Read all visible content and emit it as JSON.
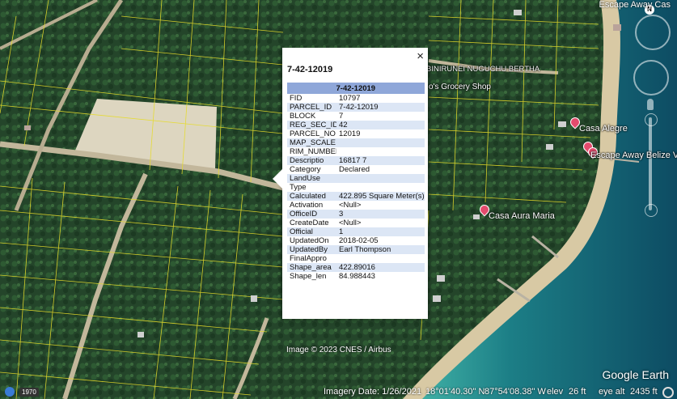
{
  "map": {
    "top_right_title": "Escape Away Cas",
    "north_indicator": "N",
    "road_label": "BINIRUNEI NUGUCHU BERTHA",
    "places": [
      {
        "label": "o's Grocery Shop",
        "pin": false
      },
      {
        "label": "Casa Alegre",
        "pin": true
      },
      {
        "label": "Escape Away Belize VR",
        "pin": true
      },
      {
        "label": "Casa Aura Maria",
        "pin": true
      }
    ],
    "copyright": "Image © 2023 CNES / Airbus",
    "logo": "Google Earth",
    "history_year": "1970"
  },
  "status_bar": {
    "imagery_date": "Imagery Date: 1/26/2021",
    "latitude": "18°01'40.30\" N",
    "longitude": "87°54'08.38\" W",
    "elev_label": "elev",
    "elev_value": "26 ft",
    "eye_alt_label": "eye alt",
    "eye_alt_value": "2435 ft"
  },
  "popup": {
    "title": "7-42-12019",
    "table_header": "7-42-12019",
    "close_glyph": "×",
    "rows": [
      {
        "field": "FID",
        "value": "10797"
      },
      {
        "field": "PARCEL_ID",
        "value": "7-42-12019"
      },
      {
        "field": "BLOCK",
        "value": "7"
      },
      {
        "field": "REG_SEC_ID",
        "value": "42"
      },
      {
        "field": "PARCEL_NO",
        "value": "12019"
      },
      {
        "field": "MAP_SCALE",
        "value": ""
      },
      {
        "field": "RIM_NUMBER",
        "value": ""
      },
      {
        "field": "Descriptio",
        "value": "16817 7"
      },
      {
        "field": "Category",
        "value": "Declared"
      },
      {
        "field": "LandUse",
        "value": ""
      },
      {
        "field": "Type",
        "value": ""
      },
      {
        "field": "Calculated",
        "value": "422.895 Square Meter(s)"
      },
      {
        "field": "Activation",
        "value": "<Null>"
      },
      {
        "field": "OfficeID",
        "value": "3"
      },
      {
        "field": "CreateDate",
        "value": "<Null>"
      },
      {
        "field": "Official",
        "value": "1"
      },
      {
        "field": "UpdatedOn",
        "value": "2018-02-05"
      },
      {
        "field": "UpdatedBy",
        "value": "Earl Thompson"
      },
      {
        "field": "FinalAppro",
        "value": ""
      },
      {
        "field": "Shape_area",
        "value": "422.89016"
      },
      {
        "field": "Shape_len",
        "value": "84.988443"
      }
    ]
  }
}
